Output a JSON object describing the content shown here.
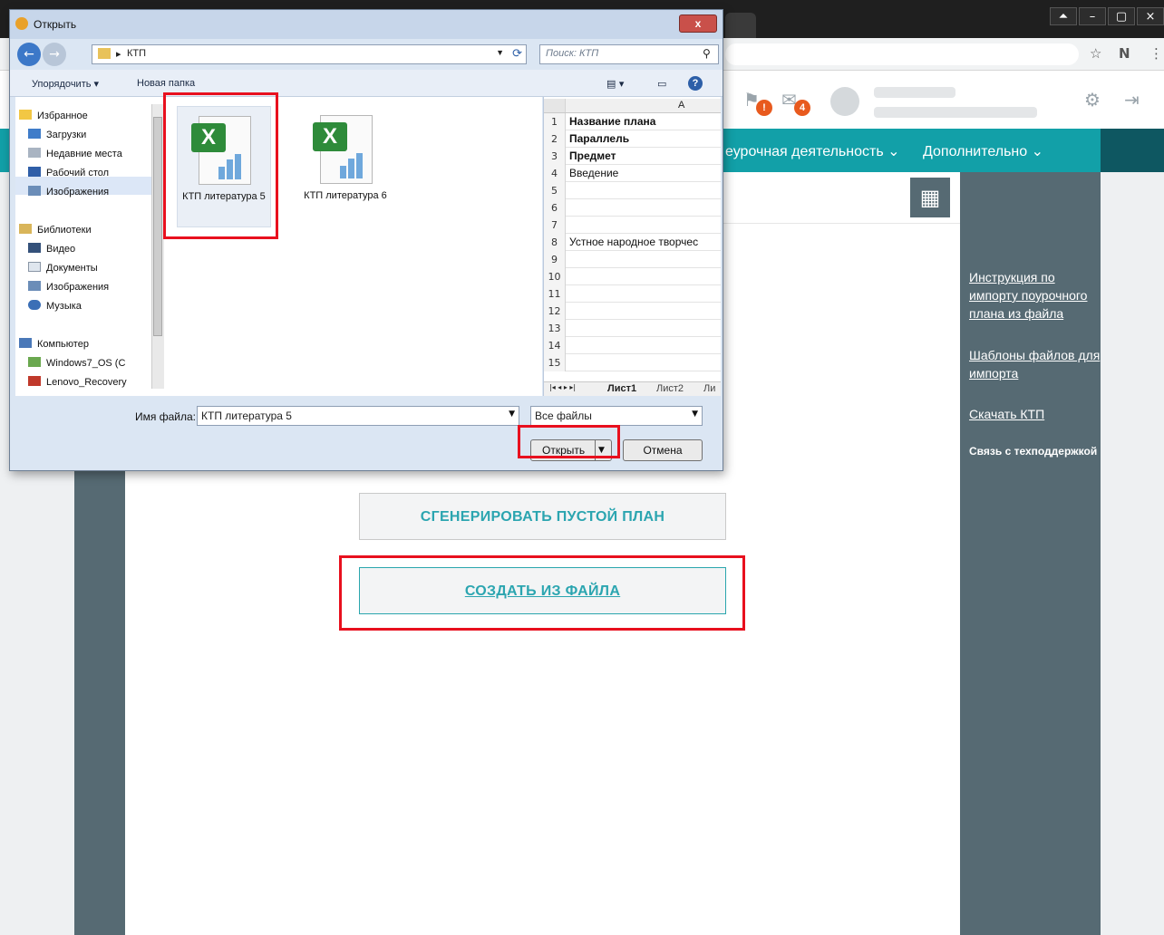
{
  "dialog": {
    "title": "Открыть",
    "close_label": "x",
    "path": "КТП",
    "search_placeholder": "Поиск: КТП",
    "toolbar": {
      "organize": "Упорядочить ▾",
      "new_folder": "Новая папка"
    },
    "tree": [
      {
        "label": "Избранное",
        "icon": "star-icon"
      },
      {
        "label": "Загрузки",
        "icon": "downloads-folder-icon"
      },
      {
        "label": "Недавние места",
        "icon": "recent-places-icon"
      },
      {
        "label": "Рабочий стол",
        "icon": "desktop-icon"
      },
      {
        "label": "Изображения",
        "icon": "pictures-icon"
      },
      {
        "label": "Библиотеки",
        "icon": "library-icon"
      },
      {
        "label": "Видео",
        "icon": "video-icon"
      },
      {
        "label": "Документы",
        "icon": "documents-icon"
      },
      {
        "label": "Изображения",
        "icon": "pictures-icon"
      },
      {
        "label": "Музыка",
        "icon": "music-icon"
      },
      {
        "label": "Компьютер",
        "icon": "computer-icon"
      },
      {
        "label": "Windows7_OS (C",
        "icon": "drive-icon"
      },
      {
        "label": "Lenovo_Recovery",
        "icon": "recovery-drive-icon"
      }
    ],
    "files": [
      {
        "name": "КТП литература 5",
        "icon": "excel-file-icon",
        "selected": true
      },
      {
        "name": "КТП литература 6",
        "icon": "excel-file-icon",
        "selected": false
      }
    ],
    "preview": {
      "column_header": "A",
      "rows": [
        {
          "n": "1",
          "text": "Название плана",
          "bold": true
        },
        {
          "n": "2",
          "text": "Параллель",
          "bold": true
        },
        {
          "n": "3",
          "text": "Предмет",
          "bold": true
        },
        {
          "n": "4",
          "text": "Введение",
          "bold": false
        },
        {
          "n": "5",
          "text": "",
          "bold": false
        },
        {
          "n": "6",
          "text": "",
          "bold": false
        },
        {
          "n": "7",
          "text": "",
          "bold": false
        },
        {
          "n": "8",
          "text": "Устное народное творчес",
          "bold": false
        },
        {
          "n": "9",
          "text": "",
          "bold": false
        },
        {
          "n": "10",
          "text": "",
          "bold": false
        },
        {
          "n": "11",
          "text": "",
          "bold": false
        },
        {
          "n": "12",
          "text": "",
          "bold": false
        },
        {
          "n": "13",
          "text": "",
          "bold": false
        },
        {
          "n": "14",
          "text": "",
          "bold": false
        },
        {
          "n": "15",
          "text": "",
          "bold": false
        }
      ],
      "sheets": [
        "Лист1",
        "Лист2",
        "Ли"
      ]
    },
    "filename_label": "Имя файла:",
    "filename_value": "КТП литература 5",
    "filetype": "Все файлы",
    "open_label": "Открыть",
    "cancel_label": "Отмена"
  },
  "header": {
    "notif_badge": "!",
    "mail_badge": "4",
    "nav": [
      "еурочная деятельность ⌄",
      "Дополнительно ⌄"
    ]
  },
  "sidebar_links": {
    "import_instructions": "Инструкция по импорту поурочного плана из файла",
    "templates": "Шаблоны файлов для импорта",
    "download": "Скачать КТП",
    "support": "Связь с техподдержкой"
  },
  "buttons": {
    "generate_empty": "СГЕНЕРИРОВАТЬ ПУСТОЙ ПЛАН",
    "create_from_file": "СОЗДАТЬ ИЗ ФАЙЛА"
  },
  "colors": {
    "accent": "#12a0a8",
    "sidebar": "#566a73",
    "highlight": "#e8101e"
  }
}
